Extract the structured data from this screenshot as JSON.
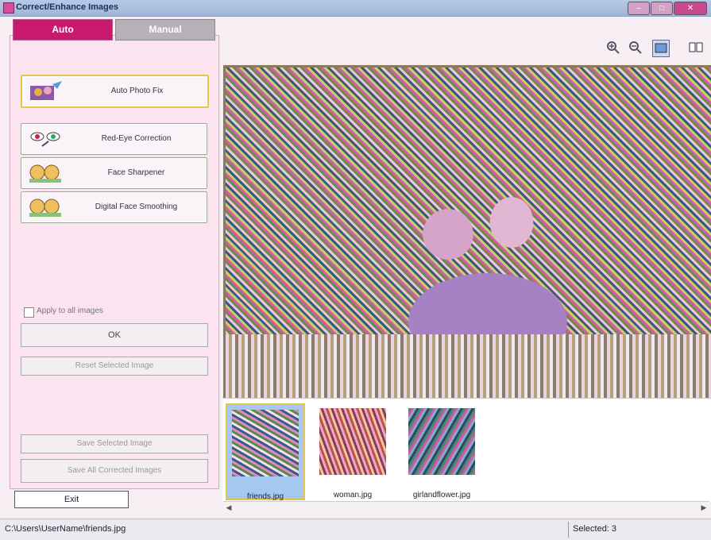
{
  "window": {
    "title": "Correct/Enhance Images",
    "minimize": "–",
    "maximize": "□",
    "close": "✕"
  },
  "tabs": [
    {
      "label": "Auto",
      "active": true
    },
    {
      "label": "Manual",
      "active": false
    }
  ],
  "auto_fixes": [
    {
      "label": "Auto Photo Fix",
      "icon": "auto-photo-fix-icon"
    },
    {
      "label": "Red-Eye Correction",
      "icon": "red-eye-icon"
    },
    {
      "label": "Face Sharpener",
      "icon": "face-sharpener-icon"
    },
    {
      "label": "Digital Face Smoothing",
      "icon": "face-smoothing-icon"
    }
  ],
  "apply_all": {
    "label": "Apply to all images",
    "checked": false
  },
  "buttons": {
    "ok": "OK",
    "reset": "Reset Selected Image",
    "save_selected": "Save Selected Image",
    "save_all": "Save All Corrected Images",
    "exit": "Exit"
  },
  "toolbar_icons": [
    "zoom-in-icon",
    "zoom-out-icon",
    "full-screen-icon",
    "compare-view-icon"
  ],
  "thumbnails": [
    {
      "name": "friends.jpg",
      "selected": true
    },
    {
      "name": "woman.jpg",
      "selected": false
    },
    {
      "name": "girlandflower.jpg",
      "selected": false
    }
  ],
  "status": {
    "path": "C:\\Users\\UserName\\friends.jpg",
    "selected": "Selected: 3"
  }
}
